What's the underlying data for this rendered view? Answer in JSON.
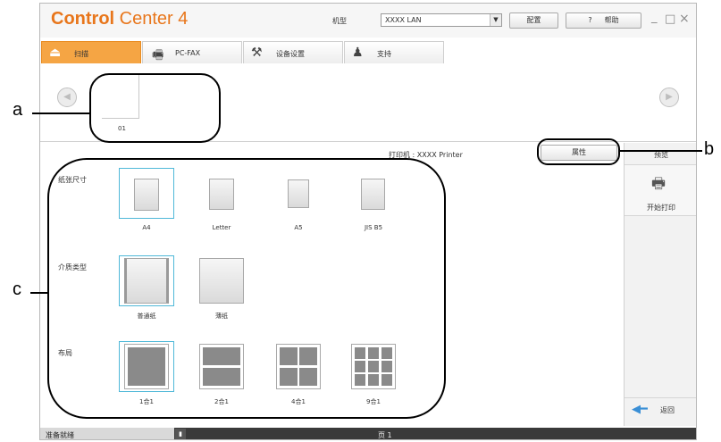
{
  "window": {
    "brand_bold": "Control",
    "brand_rest": " Center 4",
    "model_label": "机型",
    "model_value": "XXXX LAN",
    "config_button": "配置",
    "help_symbol": "?",
    "help_label": "帮助",
    "minimize": "_",
    "maximize": "□",
    "close": "×"
  },
  "tabs": [
    {
      "label": "扫描",
      "icon": "scan-icon",
      "active": true
    },
    {
      "label": "PC-FAX",
      "icon": "fax-icon",
      "active": false
    },
    {
      "label": "设备设置",
      "icon": "tools-icon",
      "active": false
    },
    {
      "label": "支持",
      "icon": "person-icon",
      "active": false
    }
  ],
  "thumbnails": {
    "page_label": "01",
    "prev_glyph": "◀",
    "next_glyph": "▶"
  },
  "printer": {
    "printer_line": "打印机 : XXXX Printer",
    "properties_button": "属性"
  },
  "sections": {
    "paper_size": "纸张尺寸",
    "media_type": "介质类型",
    "layout": "布局"
  },
  "paper_sizes": [
    {
      "label": "A4",
      "selected": true
    },
    {
      "label": "Letter",
      "selected": false
    },
    {
      "label": "A5",
      "selected": false
    },
    {
      "label": "JIS B5",
      "selected": false
    }
  ],
  "media_types": [
    {
      "label": "普通纸",
      "selected": true
    },
    {
      "label": "薄纸",
      "selected": false
    }
  ],
  "layouts": [
    {
      "label": "1合1",
      "selected": true,
      "grid": 1
    },
    {
      "label": "2合1",
      "selected": false,
      "grid": 2
    },
    {
      "label": "4合1",
      "selected": false,
      "grid": 4
    },
    {
      "label": "9合1",
      "selected": false,
      "grid": 9
    }
  ],
  "right_panel": {
    "preview": "预览",
    "start_print": "开始打印",
    "back": "返回"
  },
  "status": {
    "ready": "准备就绪",
    "page": "页 1"
  },
  "callouts": {
    "a": "a",
    "b": "b",
    "c": "c"
  },
  "colors": {
    "accent": "#f0902a",
    "selection": "#4fb8d8"
  }
}
